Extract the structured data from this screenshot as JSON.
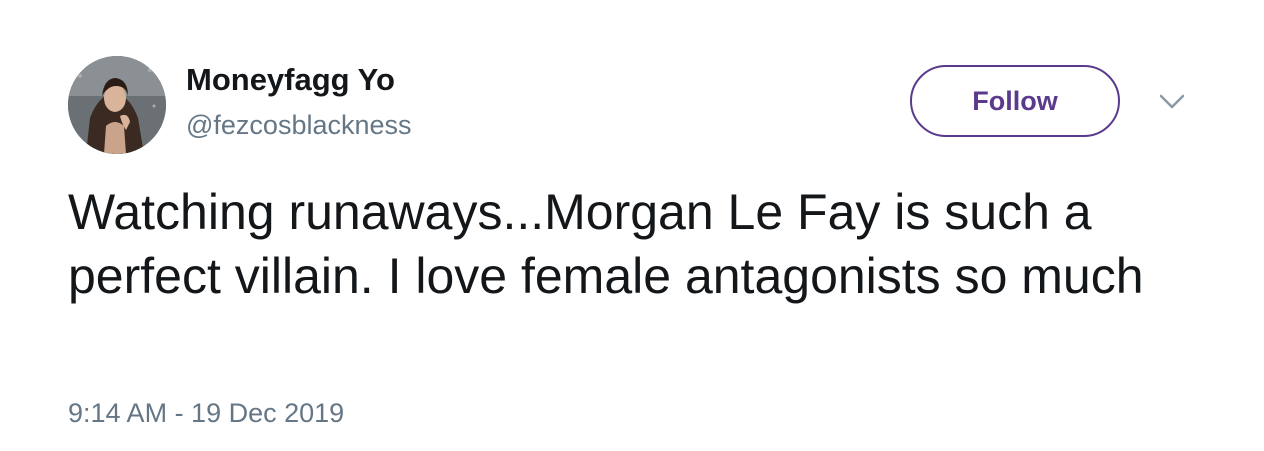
{
  "tweet": {
    "display_name": "Moneyfagg Yo",
    "username": "@fezcosblackness",
    "follow_label": "Follow",
    "text": "Watching runaways...Morgan Le Fay is such a perfect villain. I love female antagonists so much",
    "timestamp": "9:14 AM - 19 Dec 2019",
    "avatar_icon": "profile-photo",
    "menu_icon": "chevron-down-icon"
  },
  "colors": {
    "follow_accent": "#5b3a8c",
    "text": "#14171a",
    "secondary_text": "#657786"
  }
}
